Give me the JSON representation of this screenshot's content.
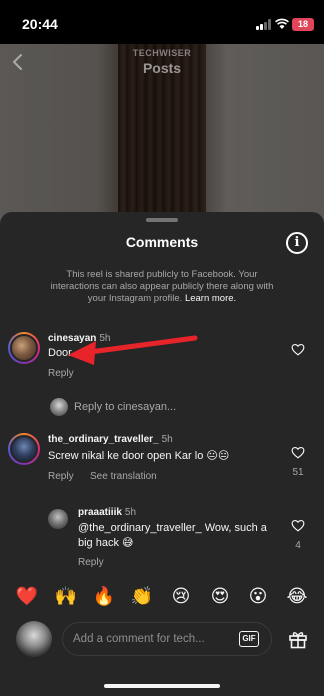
{
  "status_bar": {
    "time": "20:44",
    "battery": "18"
  },
  "header": {
    "account": "TECHWISER",
    "title": "Posts"
  },
  "sheet": {
    "title": "Comments",
    "notice": "This reel is shared publicly to Facebook. Your interactions can also appear publicly there along with your Instagram profile.",
    "learn_more": "Learn more."
  },
  "comments": [
    {
      "username": "cinesayan",
      "time": "5h",
      "text": "Door",
      "reply_label": "Reply",
      "likes": ""
    },
    {
      "username": "the_ordinary_traveller_",
      "time": "5h",
      "text": "Screw nikal ke door open Kar lo 😐😐",
      "reply_label": "Reply",
      "translate_label": "See translation",
      "likes": "51"
    }
  ],
  "reply_to": {
    "prefix": "Reply to",
    "username": "cinesayan",
    "suffix": "..."
  },
  "replies": [
    {
      "username": "praaatiiik",
      "time": "5h",
      "text": "@the_ordinary_traveller_ Wow, such a big hack 😅",
      "reply_label": "Reply",
      "likes": "4"
    }
  ],
  "emoji_bar": [
    "❤️",
    "🙌",
    "🔥",
    "👏",
    "😢",
    "😍",
    "😮",
    "😂"
  ],
  "composer": {
    "placeholder": "Add a comment for tech...",
    "gif_label": "GIF"
  },
  "colors": {
    "sheet_bg": "#262626",
    "arrow": "#e8242b",
    "heart_outline": "#f5f5f5"
  }
}
